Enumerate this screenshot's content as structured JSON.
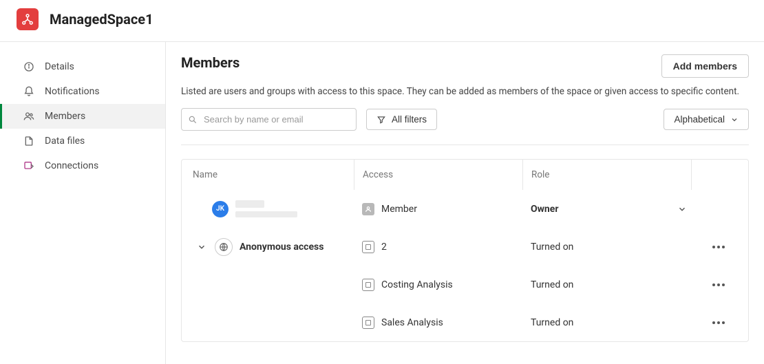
{
  "space": {
    "title": "ManagedSpace1"
  },
  "sidebar": {
    "items": [
      {
        "label": "Details"
      },
      {
        "label": "Notifications"
      },
      {
        "label": "Members"
      },
      {
        "label": "Data files"
      },
      {
        "label": "Connections"
      }
    ]
  },
  "page": {
    "title": "Members",
    "description": "Listed are users and groups with access to this space. They can be added as members of the space or given access to specific content.",
    "add_label": "Add members"
  },
  "toolbar": {
    "search_placeholder": "Search by name or email",
    "filters_label": "All filters",
    "sort_label": "Alphabetical"
  },
  "table": {
    "headers": {
      "name": "Name",
      "access": "Access",
      "role": "Role"
    },
    "rows": [
      {
        "avatar_initials": "JK",
        "access_label": "Member",
        "role_label": "Owner"
      },
      {
        "name_label": "Anonymous access",
        "access_label": "2",
        "role_label": "Turned on"
      },
      {
        "access_label": "Costing Analysis",
        "role_label": "Turned on"
      },
      {
        "access_label": "Sales Analysis",
        "role_label": "Turned on"
      }
    ]
  }
}
